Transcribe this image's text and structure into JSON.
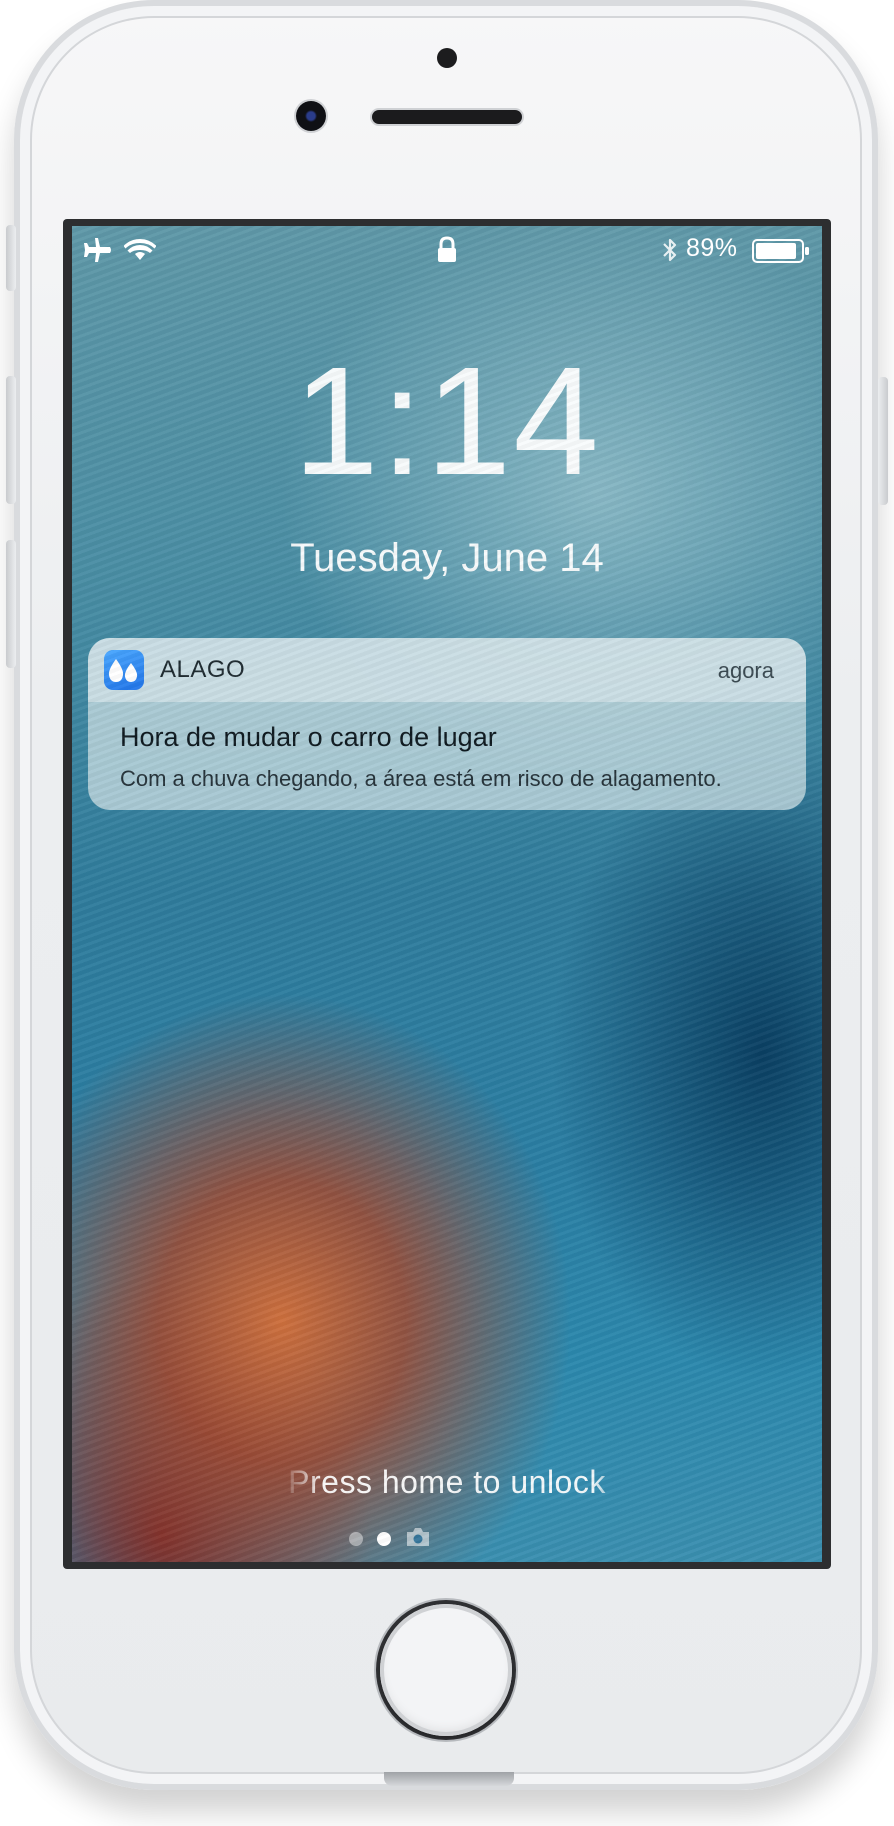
{
  "status_bar": {
    "left_icons": [
      "airplane-icon",
      "wifi-icon"
    ],
    "center_icon": "lock-icon",
    "right_icons": [
      "bluetooth-icon",
      "battery-icon"
    ],
    "battery_percent": "89%",
    "battery_level": 0.89
  },
  "lock_screen": {
    "time": "1:14",
    "date": "Tuesday, June 14"
  },
  "notification": {
    "app_icon": "water-drops-icon",
    "app_name": "ALAGO",
    "time": "agora",
    "title": "Hora de mudar o carro de lugar",
    "body": "Com a chuva chegando, a área está em risco de alagamento.",
    "accent_color": "#2f8bf5"
  },
  "bottom": {
    "unlock_text": "Press home to unlock",
    "pages": [
      "dot",
      "dot-active",
      "camera-icon"
    ]
  },
  "colors": {
    "phone_body": "#eceef0",
    "screen_frame": "#2d2e30",
    "text": "#ffffff"
  }
}
